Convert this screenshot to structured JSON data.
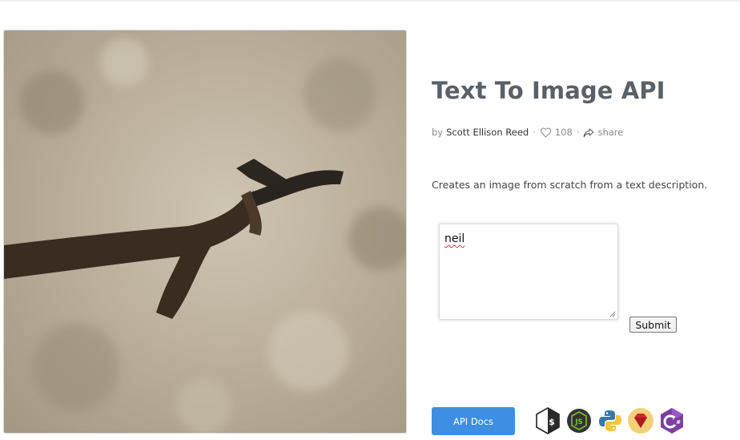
{
  "page": {
    "title": "Text To Image API",
    "by_label": "by",
    "author": "Scott Ellison Reed",
    "likes": "108",
    "share_label": "share",
    "description": "Creates an image from scratch from a text description."
  },
  "form": {
    "input_value": "neil",
    "submit_label": "Submit"
  },
  "footer": {
    "api_docs_label": "API Docs",
    "languages": [
      "shell",
      "nodejs",
      "python",
      "ruby",
      "csharp"
    ]
  },
  "icons": {
    "like": "heart-icon",
    "share": "share-icon"
  },
  "colors": {
    "accent": "#3e8fe3",
    "title": "#5a6068"
  }
}
